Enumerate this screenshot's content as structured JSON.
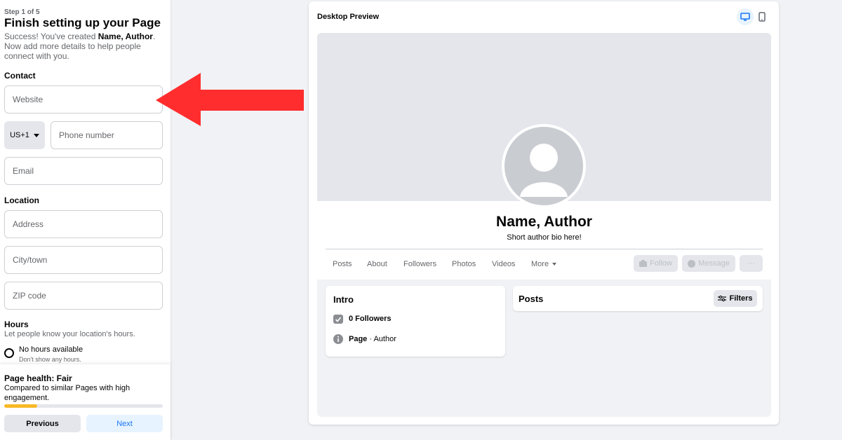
{
  "left": {
    "step": "Step 1 of 5",
    "title": "Finish setting up your Page",
    "subtitle_pre": "Success! You've created ",
    "subtitle_name": "Name, Author",
    "subtitle_post": ". Now add more details to help people connect with you.",
    "contact_heading": "Contact",
    "website_placeholder": "Website",
    "country_code": "US+1",
    "phone_placeholder": "Phone number",
    "email_placeholder": "Email",
    "location_heading": "Location",
    "address_placeholder": "Address",
    "city_placeholder": "City/town",
    "zip_placeholder": "ZIP code",
    "hours_heading": "Hours",
    "hours_sub": "Let people know your location's hours.",
    "no_hours_label": "No hours available",
    "no_hours_sub": "Don't show any hours."
  },
  "health": {
    "title": "Page health: Fair",
    "subtitle": "Compared to similar Pages with high engagement.",
    "progress_fraction": 0.21,
    "previous_label": "Previous",
    "next_label": "Next"
  },
  "preview": {
    "title": "Desktop Preview",
    "name": "Name, Author",
    "bio": "Short author bio here!",
    "tabs": [
      "Posts",
      "About",
      "Followers",
      "Photos",
      "Videos",
      "More"
    ],
    "follow_label": "Follow",
    "message_label": "Message",
    "more_actions_label": "···",
    "intro_title": "Intro",
    "followers_text": "0 Followers",
    "page_label": "Page",
    "page_category": " · Author",
    "posts_title": "Posts",
    "filters_label": "Filters"
  },
  "colors": {
    "accent": "#1877f2",
    "arrow": "#ff2d2d",
    "progress": "#f7b928"
  }
}
